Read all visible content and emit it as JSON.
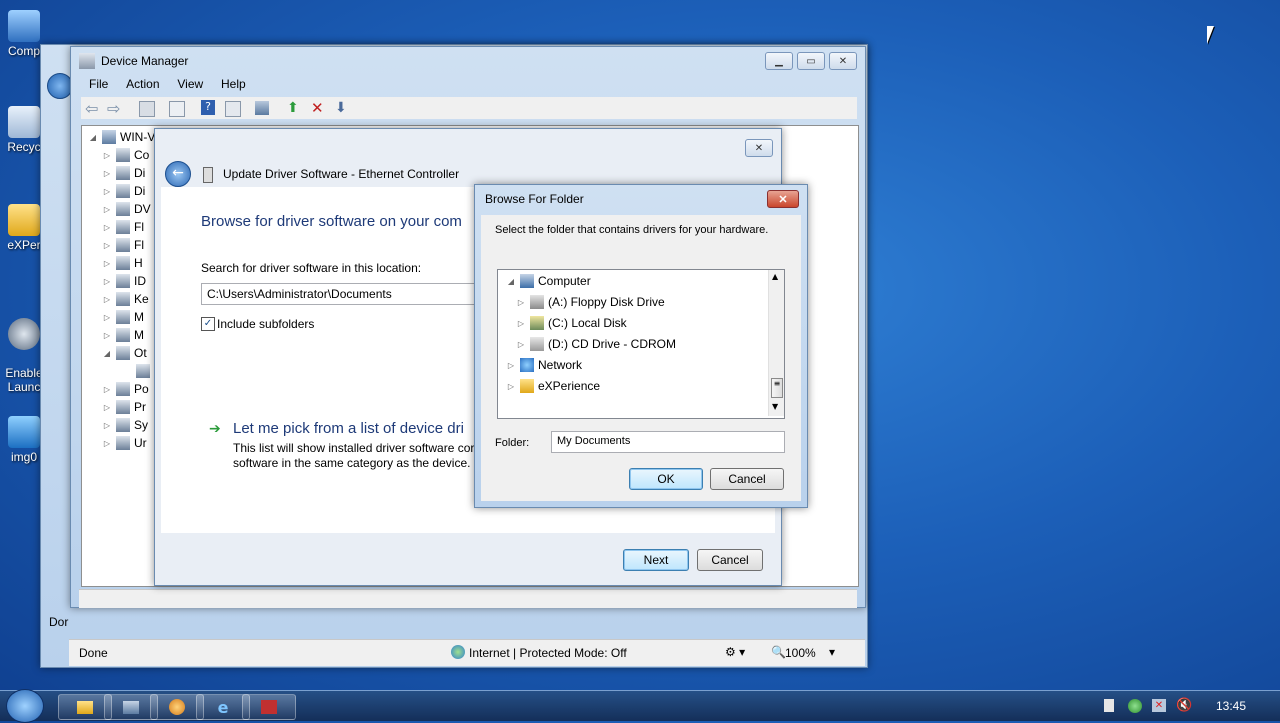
{
  "desktop": {
    "icons": [
      {
        "label": "Comp"
      },
      {
        "label": "Recyc"
      },
      {
        "label": "eXPer"
      },
      {
        "label": "Enable\nLaunc"
      },
      {
        "label": "img0"
      }
    ]
  },
  "ie_window": {
    "status_left": "Dor",
    "status_bar": {
      "done": "Done",
      "zone": "Internet | Protected Mode: Off",
      "zoom": "100%"
    }
  },
  "device_manager": {
    "title": "Device Manager",
    "menu": [
      "File",
      "Action",
      "View",
      "Help"
    ],
    "tree_root": "WIN-V",
    "tree_items": [
      "Co",
      "Di",
      "Di",
      "DV",
      "Fl",
      "Fl",
      "H",
      "ID",
      "Ke",
      "M",
      "M",
      "Ot",
      "",
      "Po",
      "Pr",
      "Sy",
      "Ur"
    ]
  },
  "update_driver": {
    "title": "Update Driver Software - Ethernet Controller",
    "heading": "Browse for driver software on your com",
    "search_label": "Search for driver software in this location:",
    "path_value": "C:\\Users\\Administrator\\Documents",
    "include_subfolders": "Include subfolders",
    "pick_title": "Let me pick from a list of device dri",
    "pick_desc_line1": "This list will show installed driver software cor",
    "pick_desc_line2": "software in the same category as the device.",
    "next": "Next",
    "cancel": "Cancel"
  },
  "browse_folder": {
    "title": "Browse For Folder",
    "instruction": "Select the folder that contains drivers for your hardware.",
    "tree": [
      {
        "label": "Computer",
        "level": 0,
        "expanded": true
      },
      {
        "label": "(A:) Floppy Disk Drive",
        "level": 1
      },
      {
        "label": "(C:) Local Disk",
        "level": 1
      },
      {
        "label": "(D:) CD Drive - CDROM",
        "level": 1
      },
      {
        "label": "Network",
        "level": 0
      },
      {
        "label": "eXPerience",
        "level": 0
      }
    ],
    "folder_label": "Folder:",
    "folder_value": "My Documents",
    "ok": "OK",
    "cancel": "Cancel"
  },
  "taskbar": {
    "clock": "13:45"
  },
  "colors": {
    "accent": "#3c7fb1",
    "desktop": "#1c5fb8"
  }
}
